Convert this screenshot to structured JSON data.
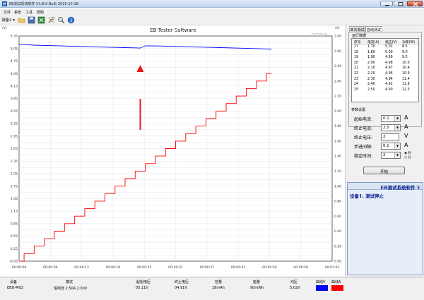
{
  "window": {
    "title": "EB测试系统软件 V1.8.0  Built 2015-10-18"
  },
  "menu": [
    "文件",
    "系统",
    "工具",
    "帮助"
  ],
  "toolbar": {
    "device_selector": "设备1"
  },
  "chart_data": {
    "type": "line",
    "title": "EB Tester Software",
    "watermark": "ZKETECH",
    "ylabel_left": "(V)",
    "ylabel_right": "(A)",
    "x_ticks": [
      "00:00:00",
      "00:00:06",
      "00:00:12",
      "00:00:18",
      "00:00:25",
      "00:00:31",
      "00:00:37",
      "00:00:43",
      "00:00:50",
      "00:00:56",
      "00:01:02"
    ],
    "y_left_ticks": [
      "5.35",
      "5.20",
      "5.05",
      "4.90",
      "4.75",
      "4.60",
      "4.45",
      "4.30",
      "4.15",
      "4.00",
      "3.85",
      "3.70",
      "3.55",
      "3.40",
      "3.25",
      "3.10",
      "2.95",
      "2.80",
      "2.65",
      "2.50",
      "2.35",
      "2.20",
      "2.05",
      "1.90",
      "1.75",
      "1.60",
      "1.45",
      "1.30",
      "1.15",
      "1.00",
      "0.85",
      "0.70",
      "0.55",
      "0.40",
      "0.25",
      "0.10",
      "-0.05"
    ],
    "y_right_ticks": [
      "3.00",
      "2.90",
      "2.80",
      "2.70",
      "2.60",
      "2.50",
      "2.40",
      "2.30",
      "2.20",
      "2.10",
      "2.00",
      "1.90",
      "1.80",
      "1.70",
      "1.60",
      "1.50",
      "1.40",
      "1.30",
      "1.20",
      "1.10",
      "1.00",
      "0.90",
      "0.80",
      "0.70",
      "0.60",
      "0.50",
      "0.40",
      "0.30",
      "0.20",
      "0.10",
      "0.00"
    ],
    "y_left_range": [
      -0.05,
      5.35
    ],
    "y_right_range": [
      0.0,
      3.0
    ],
    "x_range_seconds": [
      0,
      62
    ],
    "series": [
      {
        "name": "电压V",
        "axis": "left",
        "color": "#0000ff",
        "points": [
          [
            0,
            5.15
          ],
          [
            3,
            5.13
          ],
          [
            6,
            5.12
          ],
          [
            9,
            5.11
          ],
          [
            12,
            5.1
          ],
          [
            15,
            5.09
          ],
          [
            18,
            5.08
          ],
          [
            21,
            5.07
          ],
          [
            23,
            5.065
          ],
          [
            24,
            5.06
          ],
          [
            25,
            5.115
          ],
          [
            28,
            5.11
          ],
          [
            31,
            5.1
          ],
          [
            34,
            5.09
          ],
          [
            37,
            5.08
          ],
          [
            40,
            5.07
          ],
          [
            43,
            5.06
          ],
          [
            46,
            5.05
          ],
          [
            49,
            5.04
          ],
          [
            50,
            5.035
          ]
        ]
      },
      {
        "name": "电流A",
        "axis": "right",
        "color": "#ff0000",
        "step_seconds": 2,
        "points": [
          [
            0,
            0.0
          ],
          [
            1,
            0.1
          ],
          [
            3,
            0.2
          ],
          [
            5,
            0.3
          ],
          [
            7,
            0.4
          ],
          [
            9,
            0.5
          ],
          [
            11,
            0.6
          ],
          [
            13,
            0.7
          ],
          [
            15,
            0.8
          ],
          [
            17,
            0.9
          ],
          [
            19,
            1.0
          ],
          [
            21,
            1.1
          ],
          [
            23,
            1.2
          ],
          [
            25,
            1.3
          ],
          [
            27,
            1.4
          ],
          [
            29,
            1.5
          ],
          [
            31,
            1.6
          ],
          [
            33,
            1.7
          ],
          [
            35,
            1.8
          ],
          [
            37,
            1.9
          ],
          [
            39,
            2.0
          ],
          [
            41,
            2.1
          ],
          [
            43,
            2.2
          ],
          [
            45,
            2.3
          ],
          [
            47,
            2.4
          ],
          [
            49,
            2.5
          ],
          [
            50,
            2.5
          ]
        ]
      }
    ],
    "annotation": {
      "type": "red-arrow",
      "at_seconds": 24
    },
    "grid": true
  },
  "side": {
    "tabs": [
      "单次测试",
      "自动测试"
    ],
    "data_group_label": "运行数据",
    "table": {
      "headers": [
        "序号",
        "电流(A)",
        "电压(V)",
        "功率(W)"
      ],
      "rows": [
        [
          "17",
          "1.70",
          "5.02",
          "8.5"
        ],
        [
          "18",
          "1.80",
          "5.00",
          "9.0"
        ],
        [
          "19",
          "1.90",
          "4.99",
          "9.5"
        ],
        [
          "20",
          "2.00",
          "4.98",
          "10.0"
        ],
        [
          "21",
          "2.10",
          "4.97",
          "10.4"
        ],
        [
          "22",
          "2.20",
          "4.96",
          "10.9"
        ],
        [
          "23",
          "2.30",
          "4.94",
          "11.4"
        ],
        [
          "24",
          "2.40",
          "4.92",
          "11.8"
        ],
        [
          "25",
          "2.50",
          "4.90",
          "12.3"
        ]
      ]
    },
    "params": {
      "title": "参数设置",
      "start_current_label": "起始电流:",
      "start_current": "0.1",
      "end_current_label": "终止电流:",
      "end_current": "2.5",
      "end_voltage_label": "终止电压:",
      "end_voltage": "2",
      "step_label": "步进间隔:",
      "step": "0.1",
      "stable_label": "稳定时间:",
      "stable": "2",
      "unit_a": "A",
      "unit_v": "V",
      "unit_s": "秒",
      "unit_m": "分",
      "start_button": "开始"
    },
    "eb_panel": {
      "header": "EB测试系统软件 V",
      "status": "设备1: 测试停止"
    }
  },
  "statusbar": {
    "headers": [
      "设备",
      "模式",
      "起始电压",
      "终止电压",
      "容量",
      "能量",
      "均压",
      "曲线V",
      "曲线A"
    ],
    "values": [
      "EBD-M02",
      "恒电流 2.50A 2.00V",
      "05.11V",
      "04.91V",
      "18mAh",
      "90mWh",
      "5.02V"
    ],
    "curve_v_color": "#0000ff",
    "curve_a_color": "#ff0000"
  }
}
